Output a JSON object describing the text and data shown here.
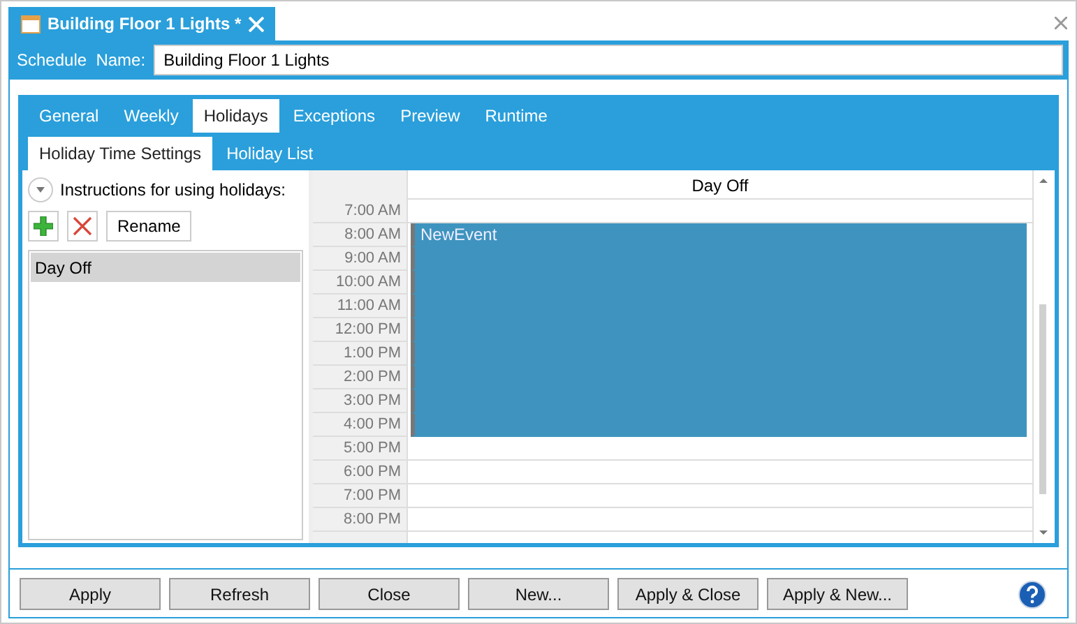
{
  "document_tab": {
    "title": "Building Floor 1 Lights *"
  },
  "schedule_name": {
    "label": "Schedule  Name:",
    "value": "Building Floor 1 Lights"
  },
  "tabs": [
    {
      "label": "General",
      "selected": false
    },
    {
      "label": "Weekly",
      "selected": false
    },
    {
      "label": "Holidays",
      "selected": true
    },
    {
      "label": "Exceptions",
      "selected": false
    },
    {
      "label": "Preview",
      "selected": false
    },
    {
      "label": "Runtime",
      "selected": false
    }
  ],
  "subtabs": [
    {
      "label": "Holiday Time Settings",
      "selected": true
    },
    {
      "label": "Holiday List",
      "selected": false
    }
  ],
  "instructions": {
    "label": "Instructions for using holidays:",
    "expanded": false
  },
  "toolbar": {
    "rename": "Rename"
  },
  "holidays": [
    {
      "name": "Day Off",
      "selected": true
    }
  ],
  "calendar": {
    "column": "Day Off",
    "event": "NewEvent",
    "slots": [
      {
        "time": "7:00 AM",
        "in_event": false
      },
      {
        "time": "8:00 AM",
        "in_event": true
      },
      {
        "time": "9:00 AM",
        "in_event": true
      },
      {
        "time": "10:00 AM",
        "in_event": true
      },
      {
        "time": "11:00 AM",
        "in_event": true
      },
      {
        "time": "12:00 PM",
        "in_event": true
      },
      {
        "time": "1:00 PM",
        "in_event": true
      },
      {
        "time": "2:00 PM",
        "in_event": true
      },
      {
        "time": "3:00 PM",
        "in_event": true
      },
      {
        "time": "4:00 PM",
        "in_event": true
      },
      {
        "time": "5:00 PM",
        "in_event": false
      },
      {
        "time": "6:00 PM",
        "in_event": false
      },
      {
        "time": "7:00 PM",
        "in_event": false
      },
      {
        "time": "8:00 PM",
        "in_event": false
      }
    ]
  },
  "buttons": [
    "Apply",
    "Refresh",
    "Close",
    "New...",
    "Apply & Close",
    "Apply & New..."
  ]
}
